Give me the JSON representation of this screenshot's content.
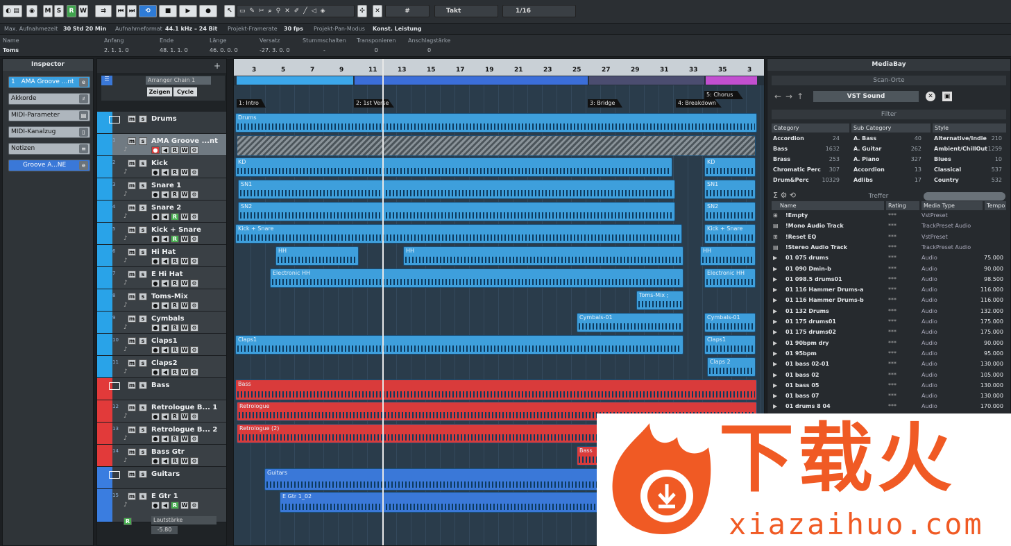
{
  "toolbar": {
    "mode_buttons": [
      "M",
      "S",
      "R",
      "W"
    ],
    "grid_label": "Takt",
    "quantize_value": "1/16"
  },
  "status": {
    "rec_time_label": "Max. Aufnahmezeit",
    "rec_time_value": "30 Std 20 Min",
    "rec_format_label": "Aufnahmeformat",
    "rec_format_value": "44.1 kHz – 24 Bit",
    "framerate_label": "Projekt-Framerate",
    "framerate_value": "30 fps",
    "pan_mode_label": "Projekt-Pan-Modus",
    "pan_mode_value": "Konst. Leistung"
  },
  "infoline": {
    "name_label": "Name",
    "name_value": "Toms",
    "start_label": "Anfang",
    "start_value": "2. 1. 1.   0",
    "end_label": "Ende",
    "end_value": "48. 1. 1.   0",
    "length_label": "Länge",
    "length_value": "46. 0. 0.   0",
    "offset_label": "Versatz",
    "offset_value": "-27. 3. 0.   0",
    "mute_label": "Stummschalten",
    "mute_value": "-",
    "transpose_label": "Transponieren",
    "transpose_value": "0",
    "velocity_label": "Anschlagstärke",
    "velocity_value": "0"
  },
  "inspector": {
    "title": "Inspector",
    "track_name": "AMA Groove ...nt",
    "track_number": "1",
    "sections": [
      "Akkorde",
      "MIDI-Parameter",
      "MIDI-Kanalzug",
      "Notizen"
    ],
    "instrument": "Groove A...NE"
  },
  "arranger_chain": {
    "label": "Arranger Chain 1",
    "show_label": "Zeigen",
    "cycle_label": "Cycle"
  },
  "tracks": [
    {
      "num": "",
      "name": "Drums",
      "type": "folder",
      "color": "#29a3e8"
    },
    {
      "num": "1",
      "name": "AMA Groove ...nt",
      "type": "instrument",
      "color": "#29a3e8"
    },
    {
      "num": "2",
      "name": "Kick",
      "type": "audio",
      "color": "#29a3e8"
    },
    {
      "num": "3",
      "name": "Snare 1",
      "type": "audio",
      "color": "#29a3e8"
    },
    {
      "num": "4",
      "name": "Snare 2",
      "type": "audio",
      "color": "#29a3e8"
    },
    {
      "num": "5",
      "name": "Kick + Snare",
      "type": "audio",
      "color": "#29a3e8"
    },
    {
      "num": "6",
      "name": "Hi Hat",
      "type": "audio",
      "color": "#29a3e8"
    },
    {
      "num": "7",
      "name": "E Hi Hat",
      "type": "audio",
      "color": "#29a3e8"
    },
    {
      "num": "8",
      "name": "Toms-Mix",
      "type": "audio",
      "color": "#29a3e8"
    },
    {
      "num": "9",
      "name": "Cymbals",
      "type": "audio",
      "color": "#29a3e8"
    },
    {
      "num": "10",
      "name": "Claps1",
      "type": "audio",
      "color": "#29a3e8"
    },
    {
      "num": "11",
      "name": "Claps2",
      "type": "audio",
      "color": "#29a3e8"
    },
    {
      "num": "",
      "name": "Bass",
      "type": "folder",
      "color": "#e23a3a"
    },
    {
      "num": "12",
      "name": "Retrologue B... 1",
      "type": "instrument",
      "color": "#e23a3a"
    },
    {
      "num": "13",
      "name": "Retrologue B... 2",
      "type": "instrument",
      "color": "#e23a3a"
    },
    {
      "num": "14",
      "name": "Bass Gtr",
      "type": "audio",
      "color": "#e23a3a"
    },
    {
      "num": "",
      "name": "Guitars",
      "type": "folder",
      "color": "#3a7de0"
    },
    {
      "num": "15",
      "name": "E Gtr 1",
      "type": "audio",
      "color": "#3a7de0"
    }
  ],
  "last_track": {
    "volume_label": "Lautstärke",
    "volume_value": "-5.80"
  },
  "ruler": [
    "3",
    "5",
    "7",
    "9",
    "11",
    "13",
    "15",
    "17",
    "19",
    "21",
    "23",
    "25",
    "27",
    "29",
    "31",
    "33",
    "35",
    "3"
  ],
  "markers": [
    "1: Intro",
    "2: 1st Verse",
    "3: Bridge",
    "4: Breakdown",
    "5: Chorus"
  ],
  "parts": {
    "drums": "Drums",
    "kd": "KD",
    "sn1": "SN1",
    "sn2": "SN2",
    "kick_snare": "Kick + Snare",
    "hh": "HH",
    "ehh": "Electronic HH",
    "toms": "Toms-Mix ;",
    "cymbals": "Cymbals-01",
    "claps1": "Claps1",
    "claps2": "Claps 2",
    "bass": "Bass",
    "retro": "Retrologue",
    "retro2": "Retrologue (2)",
    "bassg": "Bass",
    "guitars": "Guitars",
    "egtr": "E Gtr 1_02"
  },
  "mediabay": {
    "title": "MediaBay",
    "scan_label": "Scan-Orte",
    "location": "VST Sound",
    "filter_label": "Filter",
    "results_label": "Treffer",
    "columns": {
      "category": "Category",
      "subcategory": "Sub Category",
      "style": "Style"
    },
    "categories": [
      [
        "Accordion",
        "24"
      ],
      [
        "Bass",
        "1632"
      ],
      [
        "Brass",
        "253"
      ],
      [
        "Chromatic Perc",
        "307"
      ],
      [
        "Drum&Perc",
        "10329"
      ]
    ],
    "subcategories": [
      [
        "A. Bass",
        "40"
      ],
      [
        "A. Guitar",
        "262"
      ],
      [
        "A. Piano",
        "327"
      ],
      [
        "Accordion",
        "13"
      ],
      [
        "Adlibs",
        "17"
      ]
    ],
    "styles": [
      [
        "Alternative/Indie",
        "210"
      ],
      [
        "Ambient/ChillOut",
        "1259"
      ],
      [
        "Blues",
        "10"
      ],
      [
        "Classical",
        "537"
      ],
      [
        "Country",
        "532"
      ]
    ],
    "result_columns": {
      "name": "Name",
      "rating": "Rating",
      "type": "Media Type",
      "tempo": "Tempo"
    },
    "results": [
      [
        "!Empty",
        "***",
        "VstPreset",
        ""
      ],
      [
        "!Mono Audio Track",
        "***",
        "TrackPreset Audio",
        ""
      ],
      [
        "!Reset EQ",
        "***",
        "VstPreset",
        ""
      ],
      [
        "!Stereo Audio Track",
        "***",
        "TrackPreset Audio",
        ""
      ],
      [
        "01 075 drums",
        "***",
        "Audio",
        "75.000"
      ],
      [
        "01 090 Dmin-b",
        "***",
        "Audio",
        "90.000"
      ],
      [
        "01 098.5 drums01",
        "***",
        "Audio",
        "98.500"
      ],
      [
        "01 116 Hammer Drums-a",
        "***",
        "Audio",
        "116.000"
      ],
      [
        "01 116 Hammer Drums-b",
        "***",
        "Audio",
        "116.000"
      ],
      [
        "01 132 Drums",
        "***",
        "Audio",
        "132.000"
      ],
      [
        "01 175 drums01",
        "***",
        "Audio",
        "175.000"
      ],
      [
        "01 175 drums02",
        "***",
        "Audio",
        "175.000"
      ],
      [
        "01 90bpm dry",
        "***",
        "Audio",
        "90.000"
      ],
      [
        "01 95bpm",
        "***",
        "Audio",
        "95.000"
      ],
      [
        "01 bass 02-01",
        "***",
        "Audio",
        "130.000"
      ],
      [
        "01 bass 02",
        "***",
        "Audio",
        "105.000"
      ],
      [
        "01 bass 05",
        "***",
        "Audio",
        "130.000"
      ],
      [
        "01 bass 07",
        "***",
        "Audio",
        "130.000"
      ],
      [
        "01 drums 8 04",
        "***",
        "Audio",
        "170.000"
      ]
    ]
  },
  "watermark": {
    "brand": "下载火",
    "url": "xiazaihuo.com"
  }
}
